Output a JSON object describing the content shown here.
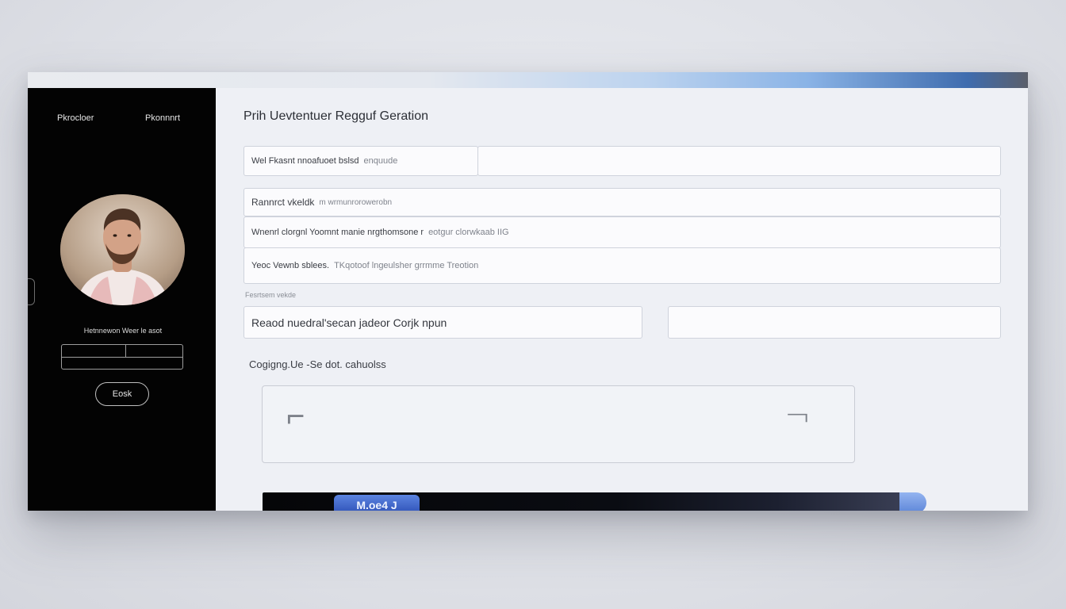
{
  "sidebar": {
    "tabs": [
      "Pkrocloer",
      "Pkonnnrt"
    ],
    "profile_name": "Hetnnewon Weer le asot",
    "button_label": "Eosk"
  },
  "main": {
    "title": "Prih Uevtentuer Regguf Geration",
    "field_name_text": "Wel Fkasnt nnoafuoet bslsd",
    "field_name_hint": "enquude",
    "row1_text": "Rannrct vkeldk",
    "row1_hint": "m  wrmunrorowerobn",
    "row2_text": "Wnenrl clorgnl  Yoomnt manie nrgthomsone r",
    "row2_hint": "eotgur clorwkaab IIG",
    "row3_text": "Yeoc Vewnb sblees.",
    "row3_hint": "TKqotoof lngeulsher  grrmme Treotion",
    "section_note": "Fesrtsem vekde",
    "half_field_text": "Reaod nuedral'secan jadeor Corjk npun",
    "config_label": "Cogigng.Ue -Se dot. cahuolss",
    "footer_badge": "M.oe4 J"
  },
  "colors": {
    "sidebar_bg": "#030303",
    "main_bg": "#eef0f5",
    "accent_blue": "#3f6cae"
  }
}
